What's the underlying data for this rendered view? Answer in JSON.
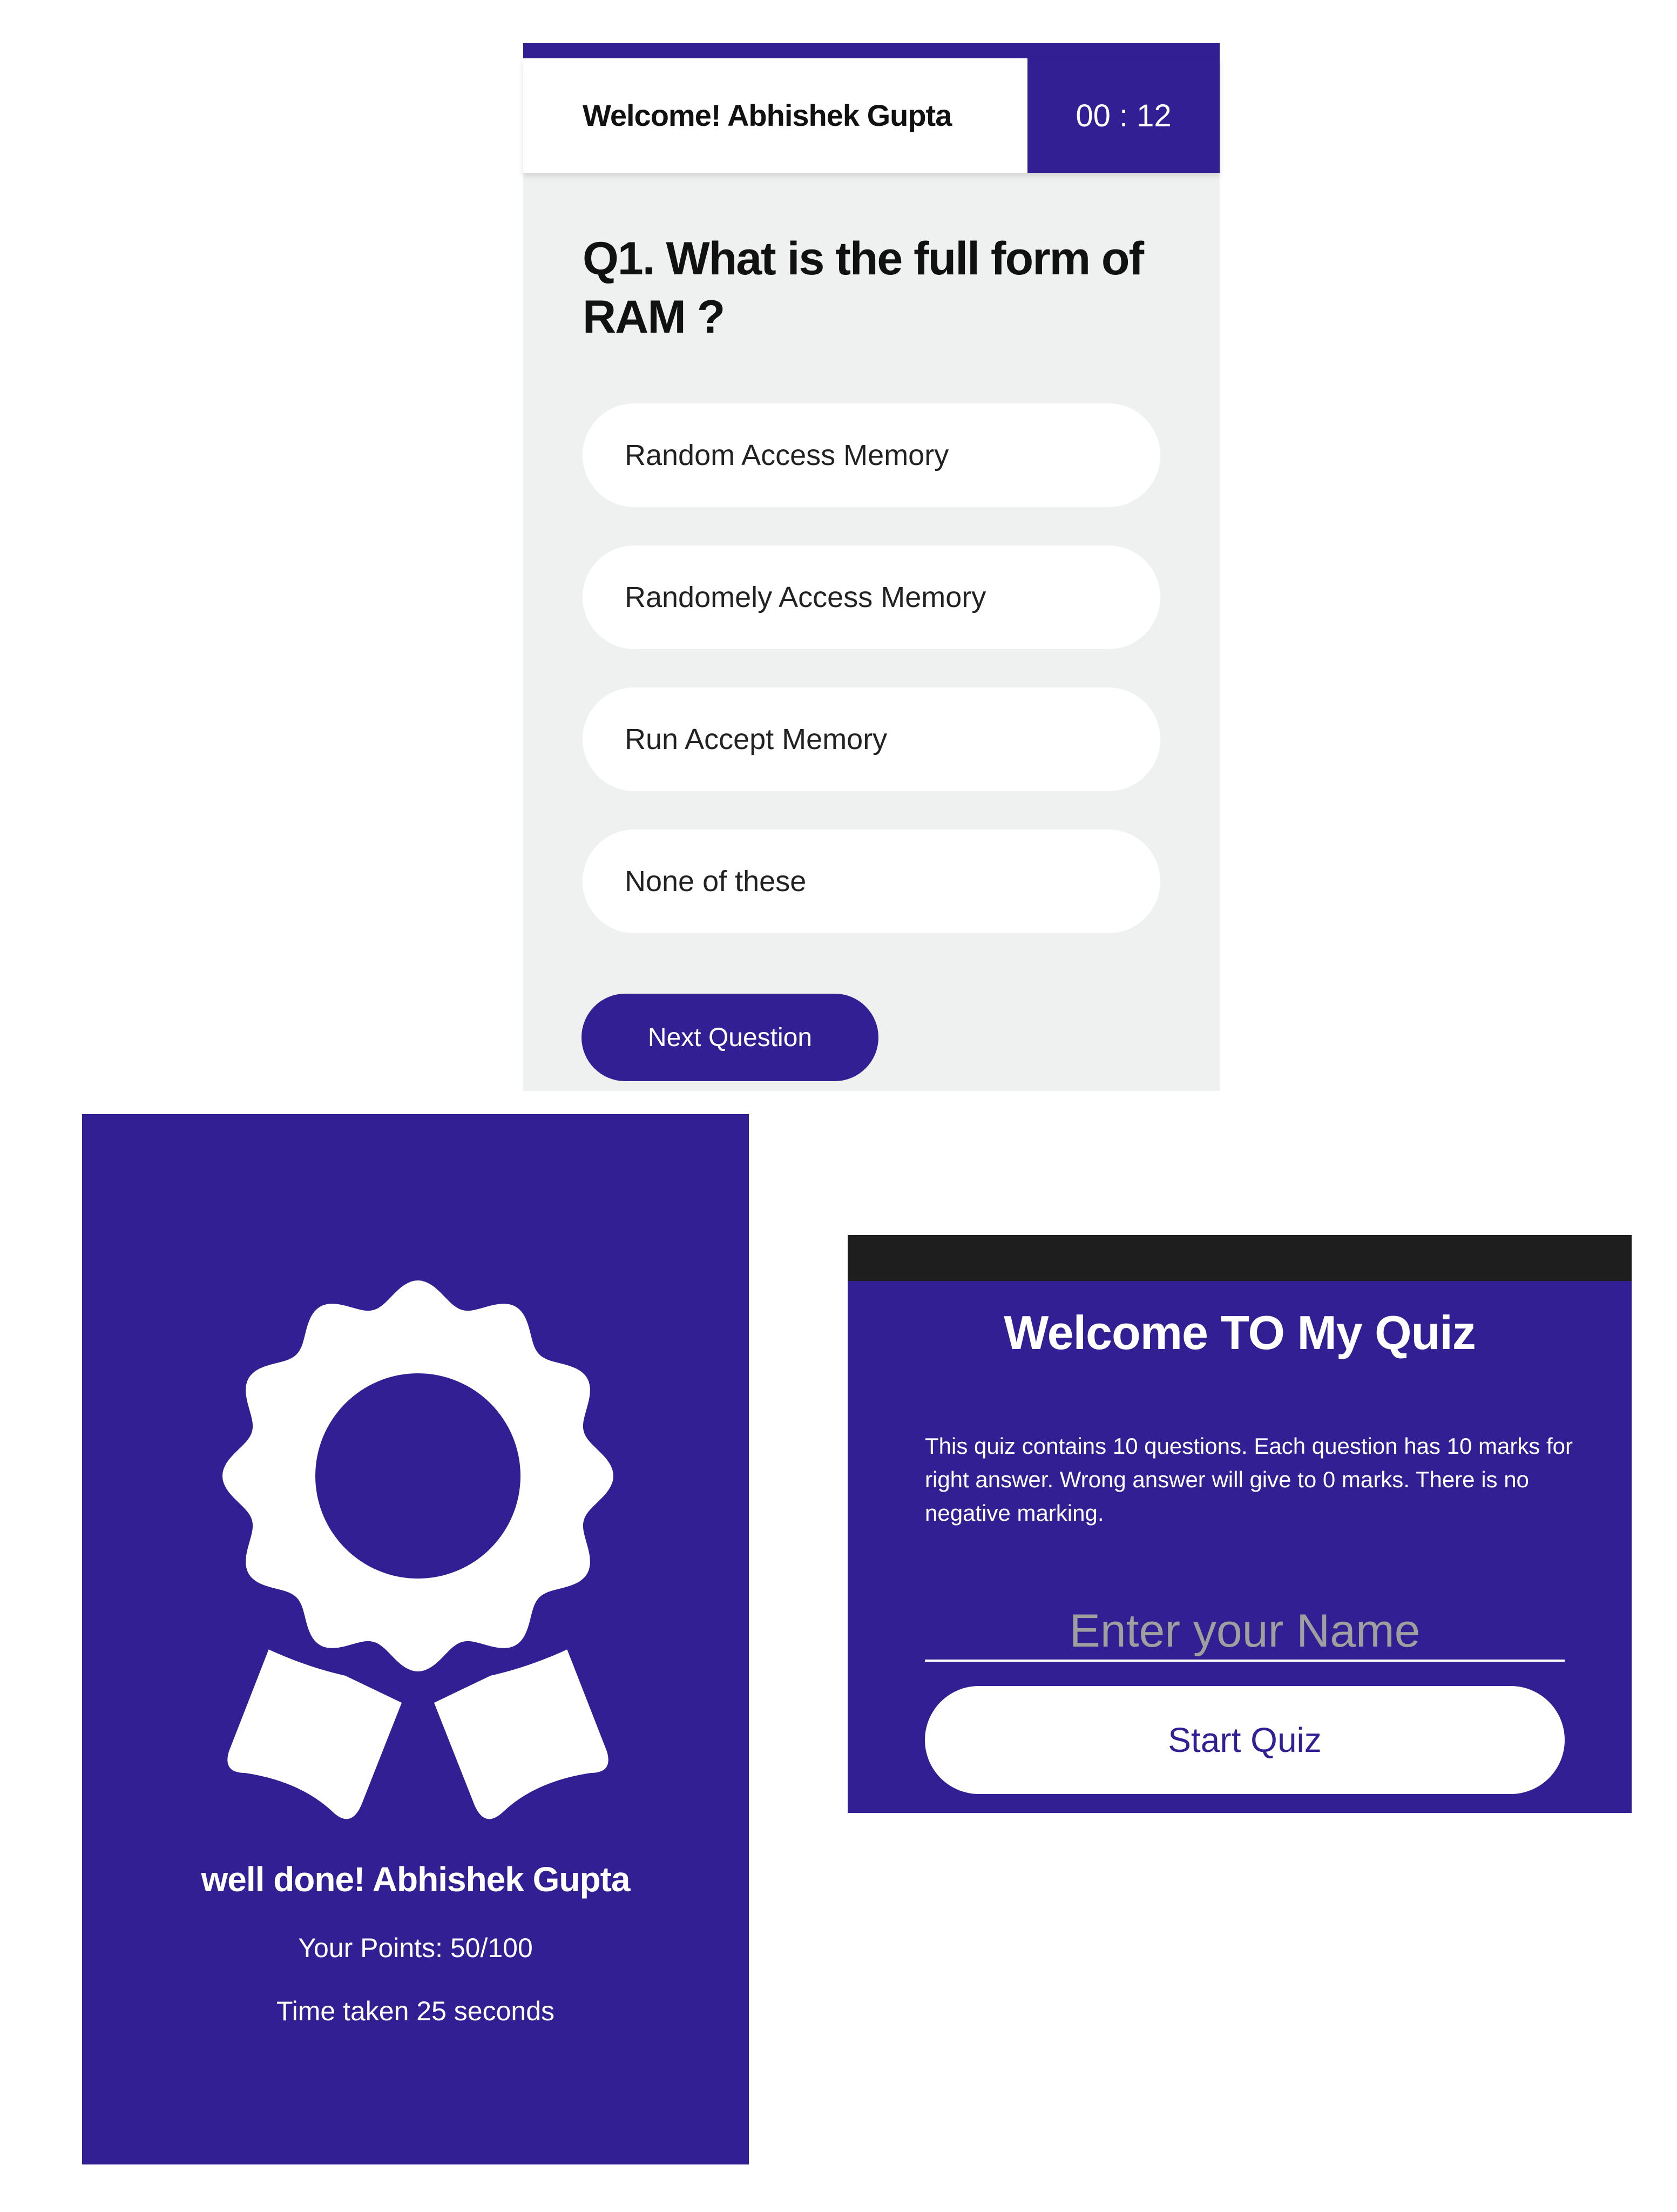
{
  "colors": {
    "primary": "#321f94",
    "quiz_background": "#eff1f1",
    "option_background": "#ffffff",
    "text_dark": "#111111",
    "text_light": "#ffffff",
    "placeholder": "#9f9f9f",
    "welcome_top_strip": "#1e1e1e"
  },
  "quiz": {
    "welcome": "Welcome! Abhishek Gupta",
    "timer": "00 : 12",
    "question": "Q1. What is the full form of RAM ?",
    "options": [
      "Random Access Memory",
      "Randomely Access Memory",
      "Run Accept Memory",
      "None of these"
    ],
    "next_label": "Next Question"
  },
  "result": {
    "icon": "award-ribbon-icon",
    "well_done": "well done! Abhishek Gupta",
    "points": "Your Points: 50/100",
    "time_taken": "Time taken 25 seconds"
  },
  "welcome": {
    "title": "Welcome TO My Quiz",
    "description": "This quiz contains 10 questions. Each question has 10 marks for right answer. Wrong answer will give to 0 marks. There is no negative marking.",
    "name_placeholder": "Enter your Name",
    "name_value": "",
    "start_label": "Start Quiz"
  }
}
